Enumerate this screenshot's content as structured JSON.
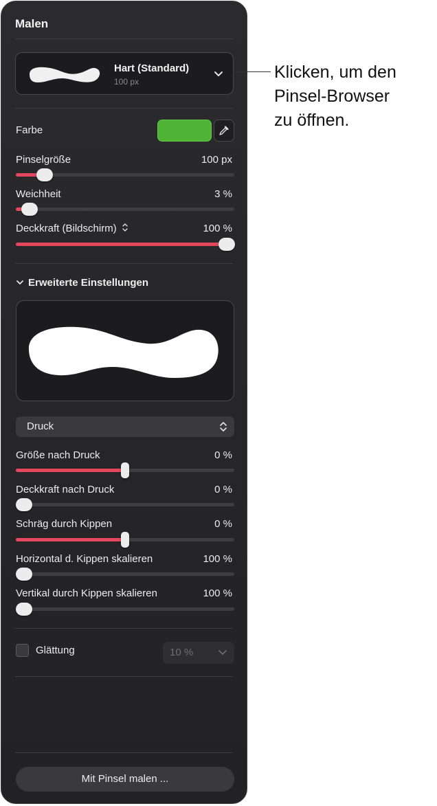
{
  "panel": {
    "title": "Malen",
    "brush": {
      "name": "Hart (Standard)",
      "size": "100 px"
    },
    "color_label": "Farbe",
    "color_value": "#4fb435",
    "sliders": [
      {
        "label": "Pinselgröße",
        "value": "100 px"
      },
      {
        "label": "Weichheit",
        "value": "3 %"
      },
      {
        "label": "Deckkraft (Bildschirm)",
        "value": "100 %"
      }
    ],
    "advanced_label": "Erweiterte Einstellungen",
    "pressure_select": "Druck",
    "pressure_sliders": [
      {
        "label": "Größe nach Druck",
        "value": "0 %"
      },
      {
        "label": "Deckkraft nach Druck",
        "value": "0 %"
      },
      {
        "label": "Schräg durch Kippen",
        "value": "0 %"
      },
      {
        "label": "Horizontal d. Kippen skalieren",
        "value": "100 %"
      },
      {
        "label": "Vertikal durch Kippen skalieren",
        "value": "100 %"
      }
    ],
    "smoothing_label": "Glättung",
    "smoothing_value": "10 %",
    "paint_button": "Mit Pinsel malen ..."
  },
  "callout": "Klicken, um den\nPinsel-Browser\nzu öffnen.",
  "icons": [
    "chevron-down-icon",
    "eyedropper-icon",
    "up-down-chevron-icon",
    "disclosure-chevron-icon"
  ]
}
